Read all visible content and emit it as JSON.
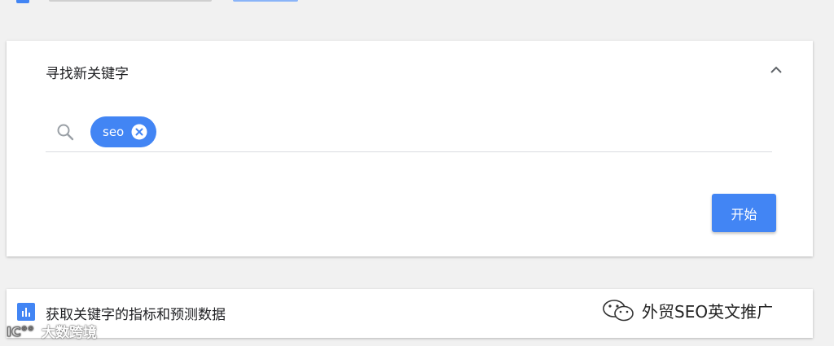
{
  "colors": {
    "accent": "#4285f4",
    "background": "#f1f1f1",
    "card": "#ffffff"
  },
  "find_card": {
    "title": "寻找新关键字",
    "collapse_icon": "chevron-up-icon",
    "search": {
      "icon": "search-icon",
      "chips": [
        {
          "label": "seo",
          "remove_icon": "close-circle-icon"
        }
      ]
    },
    "start_label": "开始"
  },
  "metrics_card": {
    "icon": "bar-chart-icon",
    "title": "获取关键字的指标和预测数据"
  },
  "watermarks": {
    "left_text": "大数跨境",
    "right_text": "外贸SEO英文推广"
  }
}
